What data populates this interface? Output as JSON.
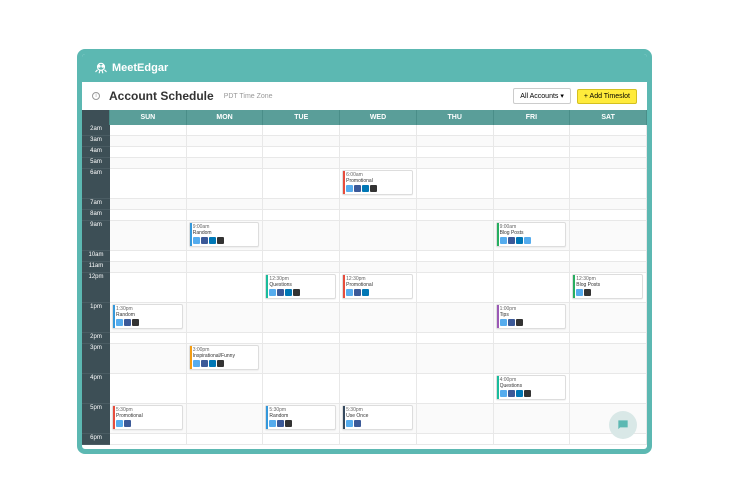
{
  "brand": "MeetEdgar",
  "page_title": "Account Schedule",
  "timezone": "PDT Time Zone",
  "buttons": {
    "accounts": "All Accounts",
    "add_timeslot": "+ Add Timeslot"
  },
  "days": [
    "SUN",
    "MON",
    "TUE",
    "WED",
    "THU",
    "FRI",
    "SAT"
  ],
  "hours": [
    "2am",
    "3am",
    "4am",
    "5am",
    "6am",
    "7am",
    "8am",
    "9am",
    "10am",
    "11am",
    "12pm",
    "1pm",
    "2pm",
    "3pm",
    "4pm",
    "5pm",
    "6pm"
  ],
  "tall_rows": [
    "6am",
    "9am",
    "12pm",
    "1pm",
    "3pm",
    "4pm",
    "5pm"
  ],
  "colors": {
    "Promotional": "#e74c3c",
    "Random": "#3498db",
    "Questions": "#1abc9c",
    "Inspirational/Funny": "#f39c12",
    "Tips": "#9b59b6",
    "Blog Posts": "#27ae60",
    "Use Once": "#34495e"
  },
  "events": [
    {
      "day": 3,
      "hour": "6am",
      "time": "6:00am",
      "category": "Promotional",
      "icons": [
        "tw",
        "fb",
        "li",
        "bk"
      ]
    },
    {
      "day": 1,
      "hour": "9am",
      "time": "9:00am",
      "category": "Random",
      "icons": [
        "tw",
        "fb",
        "li",
        "bk"
      ]
    },
    {
      "day": 5,
      "hour": "9am",
      "time": "9:00am",
      "category": "Blog Posts",
      "icons": [
        "tw",
        "fb",
        "li",
        "tw"
      ]
    },
    {
      "day": 2,
      "hour": "12pm",
      "time": "12:30pm",
      "category": "Questions",
      "icons": [
        "tw",
        "fb",
        "li",
        "bk"
      ]
    },
    {
      "day": 3,
      "hour": "12pm",
      "time": "12:30pm",
      "category": "Promotional",
      "icons": [
        "tw",
        "fb",
        "li"
      ]
    },
    {
      "day": 6,
      "hour": "12pm",
      "time": "12:30pm",
      "category": "Blog Posts",
      "icons": [
        "tw",
        "bk"
      ]
    },
    {
      "day": 0,
      "hour": "1pm",
      "time": "1:30pm",
      "category": "Random",
      "icons": [
        "tw",
        "fb",
        "bk"
      ]
    },
    {
      "day": 5,
      "hour": "1pm",
      "time": "1:00pm",
      "category": "Tips",
      "icons": [
        "tw",
        "fb",
        "bk"
      ]
    },
    {
      "day": 1,
      "hour": "3pm",
      "time": "3:00pm",
      "category": "Inspirational/Funny",
      "icons": [
        "tw",
        "fb",
        "li",
        "bk"
      ]
    },
    {
      "day": 5,
      "hour": "4pm",
      "time": "4:00pm",
      "category": "Questions",
      "icons": [
        "tw",
        "fb",
        "li",
        "bk"
      ]
    },
    {
      "day": 0,
      "hour": "5pm",
      "time": "5:30pm",
      "category": "Promotional",
      "icons": [
        "tw",
        "fb"
      ]
    },
    {
      "day": 2,
      "hour": "5pm",
      "time": "5:30pm",
      "category": "Random",
      "icons": [
        "tw",
        "fb",
        "bk"
      ]
    },
    {
      "day": 3,
      "hour": "5pm",
      "time": "5:30pm",
      "category": "Use Once",
      "icons": [
        "tw",
        "fb"
      ]
    }
  ]
}
